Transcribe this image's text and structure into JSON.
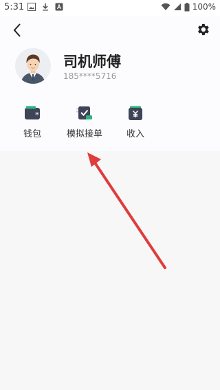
{
  "status_bar": {
    "time": "5:31",
    "battery": "100%"
  },
  "profile": {
    "name": "司机师傅",
    "phone": "185****5716"
  },
  "menu": {
    "items": [
      {
        "label": "钱包",
        "icon": "wallet-icon"
      },
      {
        "label": "模拟接单",
        "icon": "simulate-order-icon"
      },
      {
        "label": "收入",
        "icon": "income-icon"
      }
    ]
  },
  "colors": {
    "icon_dark": "#3f4456",
    "accent_green": "#2cb67d",
    "annotation_red": "#e03c3c"
  }
}
